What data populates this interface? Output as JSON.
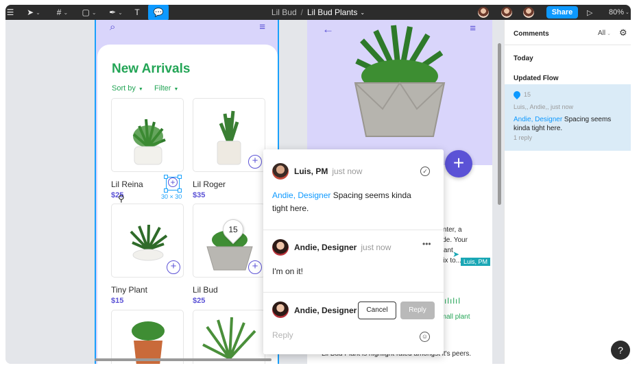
{
  "toolbar": {
    "breadcrumb_project": "Lil Bud",
    "breadcrumb_sep": "/",
    "file_name": "Lil Bud Plants",
    "share_label": "Share",
    "zoom": "80%",
    "text_tool": "T"
  },
  "list_frame": {
    "title": "New Arrivals",
    "sort_label": "Sort by",
    "filter_label": "Filter",
    "products": [
      {
        "name": "Lil Reina",
        "price": "$25"
      },
      {
        "name": "Lil Roger",
        "price": "$35"
      },
      {
        "name": "Tiny Plant",
        "price": "$15"
      },
      {
        "name": "Lil Bud",
        "price": "$25"
      }
    ],
    "selection_size": "30 × 30",
    "comment_count": "15"
  },
  "detail_frame": {
    "desc_lines": [
      "lanter, a",
      "vide. Your",
      "Plant",
      "mix to..."
    ],
    "small_plant": "Small plant",
    "bottom_text": "Lil Bud Plant is highlight rated amongst it's peers.",
    "cursor_user": "Luis, PM"
  },
  "thread": {
    "c1_author": "Luis, PM",
    "c1_time": "just now",
    "c1_mention": "Andie, Designer",
    "c1_text": " Spacing seems kinda tight here.",
    "c2_author": "Andie, Designer",
    "c2_time": "just now",
    "c2_text": "I'm on it!",
    "c3_author": "Andie, Designer",
    "cancel": "Cancel",
    "reply": "Reply",
    "reply_placeholder": "Reply"
  },
  "panel": {
    "title": "Comments",
    "filter": "All",
    "today": "Today",
    "group": "Updated Flow",
    "pin_num": "15",
    "names": "Luis,, Andie,, just now",
    "mention": "Andie, Designer",
    "msg": " Spacing seems kinda tight here.",
    "replies": "1 reply"
  },
  "help": "?",
  "colors": {
    "accent_blue": "#0d99ff",
    "brand_green": "#23a556",
    "brand_purple": "#5b52d6"
  }
}
